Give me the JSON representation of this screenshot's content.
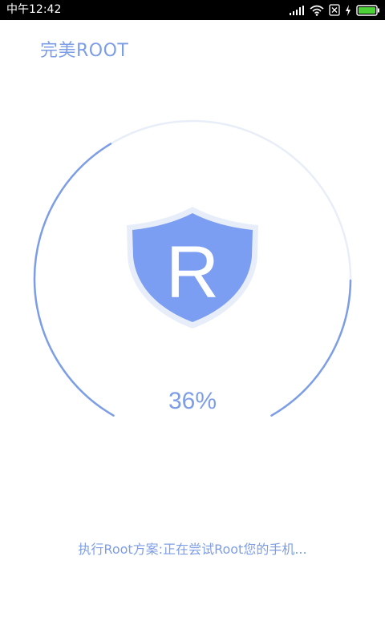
{
  "status_bar": {
    "time": "中午12:42",
    "icons": [
      "signal-bars-icon",
      "wifi-icon",
      "sim-disabled-icon",
      "charging-bolt-icon",
      "battery-icon"
    ]
  },
  "app": {
    "title": "完美ROOT"
  },
  "progress": {
    "value": 36,
    "label": "36%"
  },
  "shield": {
    "letter": "R",
    "icon": "shield-icon"
  },
  "status_message": "执行Root方案:正在尝试Root您的手机...",
  "colors": {
    "accent": "#7d9ee6",
    "shield_fill": "#7b9ef2",
    "shield_rim": "#e8eef9",
    "ring_track": "#e8eef8",
    "ring_progress": "#7d9ee6",
    "status_bar_bg": "#000000",
    "background": "#ffffff"
  }
}
